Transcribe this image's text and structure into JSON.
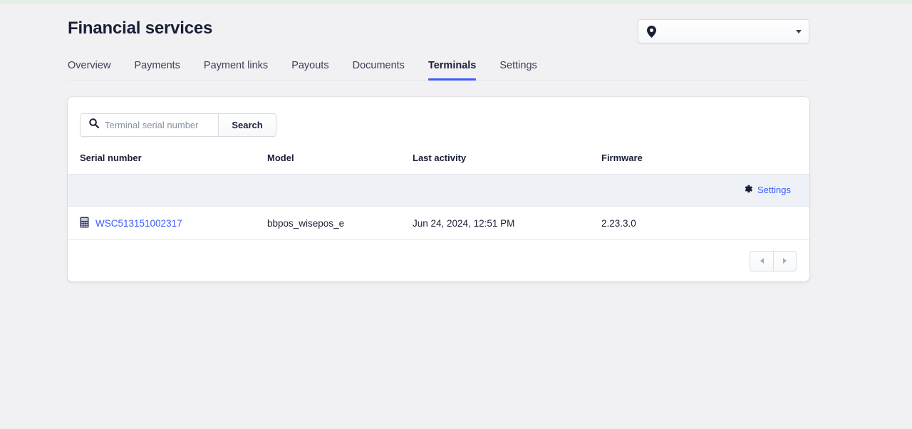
{
  "header": {
    "title": "Financial services",
    "account_picker": {
      "icon": "location-pin-icon",
      "value": "",
      "caret_icon": "chevron-down-icon"
    }
  },
  "tabs": [
    {
      "label": "Overview",
      "active": false
    },
    {
      "label": "Payments",
      "active": false
    },
    {
      "label": "Payment links",
      "active": false
    },
    {
      "label": "Payouts",
      "active": false
    },
    {
      "label": "Documents",
      "active": false
    },
    {
      "label": "Terminals",
      "active": true
    },
    {
      "label": "Settings",
      "active": false
    }
  ],
  "toolbar": {
    "search_icon": "search-icon",
    "search_placeholder": "Terminal serial number",
    "search_value": "",
    "search_button_label": "Search"
  },
  "table": {
    "columns": [
      "Serial number",
      "Model",
      "Last activity",
      "Firmware"
    ],
    "settings_row": {
      "icon": "gear-icon",
      "label": "Settings"
    },
    "rows": [
      {
        "icon": "card-reader-icon",
        "serial_number": "WSC513151002317",
        "model": "bbpos_wisepos_e",
        "last_activity": "Jun 24, 2024, 12:51 PM",
        "firmware": "2.23.3.0"
      }
    ]
  },
  "pagination": {
    "previous_icon": "triangle-left-icon",
    "next_icon": "triangle-right-icon"
  },
  "colors": {
    "accent": "#3b5bfd",
    "page_background": "#f1f0f3",
    "top_strip": "#e3f0e5",
    "settings_row_background": "#eef1f6",
    "border": "#e3e8ee"
  }
}
